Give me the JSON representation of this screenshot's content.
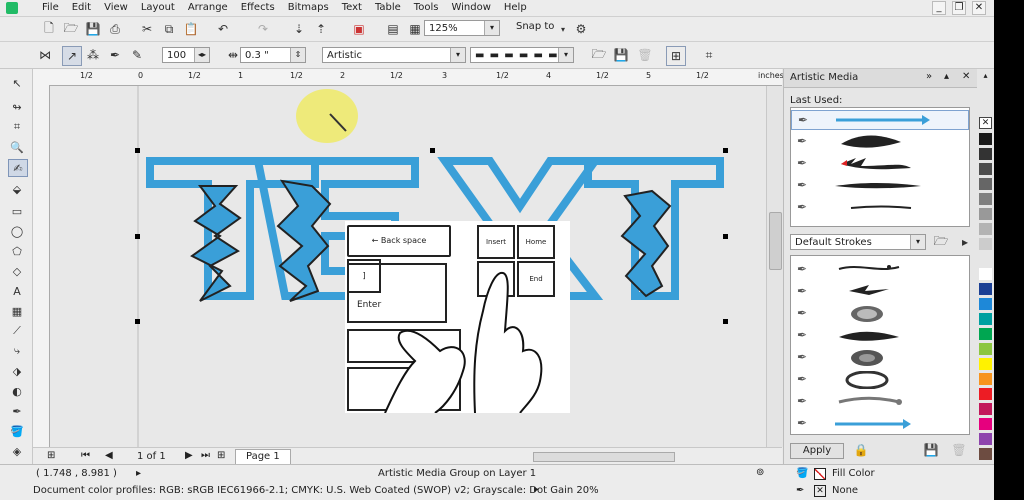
{
  "menubar": {
    "items": [
      "File",
      "Edit",
      "View",
      "Layout",
      "Arrange",
      "Effects",
      "Bitmaps",
      "Text",
      "Table",
      "Tools",
      "Window",
      "Help"
    ]
  },
  "toolbar": {
    "zoom_value": "125%",
    "snap_label": "Snap to"
  },
  "propbar": {
    "size_value": "100",
    "width_value": "0.3 \"",
    "preset_value": "Artistic"
  },
  "ruler": {
    "unit": "inches",
    "labels": [
      "1/2",
      "0",
      "1/2",
      "1",
      "1/2",
      "2",
      "1/2",
      "3",
      "1/2",
      "4",
      "1/2",
      "5",
      "1/2"
    ]
  },
  "canvas": {
    "text": "TEXT",
    "accent_color": "#3a9fd8",
    "overlay_keys": {
      "backspace": "← Back space",
      "insert": "Insert",
      "home": "Home",
      "end": "End",
      "enter": "Enter"
    }
  },
  "pages": {
    "counter": "1 of 1",
    "page_tab": "Page 1"
  },
  "docker": {
    "title": "Artistic Media",
    "last_used_label": "Last Used:",
    "strokes_dropdown": "Default Strokes",
    "apply_label": "Apply"
  },
  "status": {
    "coords": "( 1.748 , 8.981 )",
    "message": "Artistic Media Group on Layer 1",
    "color_profiles": "Document color profiles: RGB: sRGB IEC61966-2.1; CMYK: U.S. Web Coated (SWOP) v2; Grayscale: Dot Gain 20%",
    "fill_label": "Fill Color",
    "outline_label": "None"
  },
  "palette_colors": [
    "#1a1a1a",
    "#333333",
    "#4d4d4d",
    "#666666",
    "#808080",
    "#999999",
    "#b3b3b3",
    "#cccccc",
    "#e6e6e6",
    "#ffffff",
    "#1b3f94",
    "#1e88d8",
    "#00a0a0",
    "#00a651",
    "#8cc63f",
    "#fff200",
    "#f7941d",
    "#ed1c24",
    "#c2185b",
    "#e6007e",
    "#8e44ad",
    "#6d4c41"
  ]
}
